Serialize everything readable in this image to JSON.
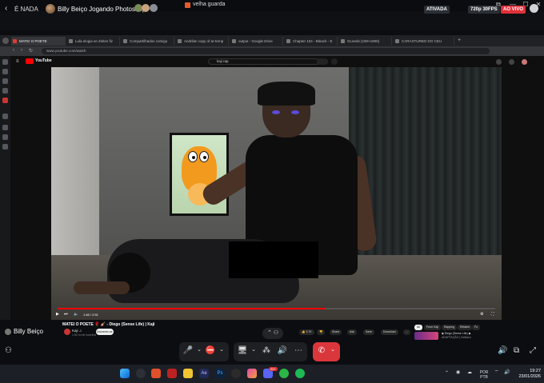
{
  "window": {
    "title": "velha guarda",
    "controls": [
      "⧉",
      "—",
      "☐",
      "✕"
    ]
  },
  "stream": {
    "server": "É NADA",
    "streamer": "Billy Beiço Jogando Photoshop",
    "badge_ativada": "ATIVADA",
    "badge_quality": "720p 30FPS",
    "badge_live": "AO VIVO",
    "viewer_name": "Billy Beiço",
    "accent_live": "#e0303a"
  },
  "browser": {
    "tabs": [
      {
        "label": "MATEI O POETE",
        "active": true
      },
      {
        "label": "Lula elogia se Zielen fiz"
      },
      {
        "label": "Compartilhados comigo"
      },
      {
        "label": "Andrilan copy of ar-ternp"
      },
      {
        "label": "output - Google Drive"
      },
      {
        "label": "Chapter 104 - Bleach - E"
      },
      {
        "label": "GLeeds (190×1900)"
      },
      {
        "label": "CARAXTURBO DO CEU"
      }
    ],
    "url": "www.youtube.com/watch"
  },
  "youtube": {
    "logo_text": "YouTube",
    "search_value": "kaji rap",
    "video_time": "1:46 / 2:51",
    "video_title": "MATEI O POETE 🌹 🎸 - Diego (Sense Life) | Kaji",
    "channel_name": "Kaji ♫",
    "channel_subs": "1,54 mi de inscritos",
    "subscribe_label": "Inscrever-se",
    "actions": [
      "👍 3,7K",
      "👎",
      "Share",
      "Ask",
      "Save",
      "Download",
      "..."
    ],
    "chips": [
      {
        "label": "All",
        "on": true
      },
      {
        "label": "From Kaji"
      },
      {
        "label": "Rapping"
      },
      {
        "label": "Related"
      },
      {
        "label": "Fo"
      }
    ],
    "next_video": "◆ Diego (Sense Life) ◆",
    "next_video_sub": "ADAPTAÇÃO | KaBaLe"
  },
  "controls": {
    "mic": "🎤",
    "camera_off": "⛔",
    "share": "🖥",
    "activities": "⁂",
    "soundboard": "🔊",
    "more": "⋯",
    "end_call": "✆",
    "volume": "🔊",
    "popout": "⧉",
    "fullscreen": "⤢"
  },
  "taskbar": {
    "apps": [
      "start",
      "search",
      "brave",
      "files",
      "photoshop-ae",
      "photoshop",
      "obs",
      "app-a",
      "app-b",
      "discord",
      "whatsapp",
      "spotify"
    ],
    "lang_top": "POR",
    "lang_bottom": "PTB",
    "time": "19:27",
    "date": "23/01/2026",
    "whatsapp_badge": "99+"
  }
}
